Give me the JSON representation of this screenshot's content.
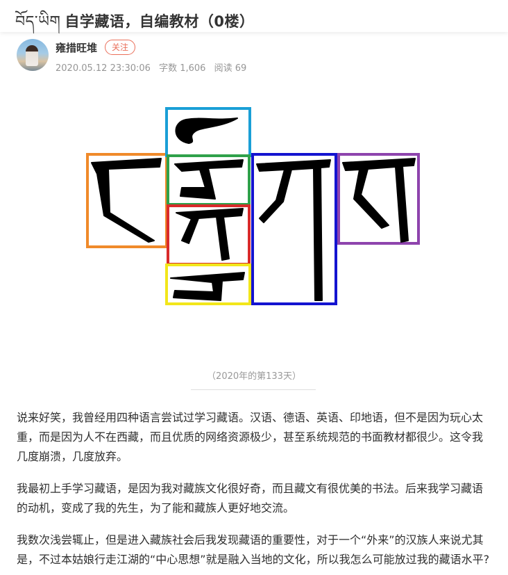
{
  "header": {
    "tibetan_logo": "བོད་ཡིག",
    "title": "自学藏语，自编教材（0楼）"
  },
  "author": {
    "name": "雍措旺堆",
    "follow_label": "关注",
    "date": "2020.05.12 23:30:06",
    "word_count": "字数 1,606",
    "reads": "阅读 69"
  },
  "figure": {
    "caption": "（2020年的第133天）",
    "box_colors": [
      "#f08a2a",
      "#1a9fd6",
      "#2fa14a",
      "#d92b2b",
      "#f2e61a",
      "#1414d0",
      "#8e44ad"
    ]
  },
  "paragraphs": [
    "说来好笑，我曾经用四种语言尝试过学习藏语。汉语、德语、英语、印地语，但不是因为玩心太重，而是因为人不在西藏，而且优质的网络资源极少，甚至系统规范的书面教材都很少。这令我几度崩溃，几度放弃。",
    "我最初上手学习藏语，是因为我对藏族文化很好奇，而且藏文有很优美的书法。后来我学习藏语的动机，变成了我的先生，为了能和藏族人更好地交流。",
    "我数次浅尝辄止，但是进入藏族社会后我发现藏语的重要性，对于一个“外来”的汉族人来说尤其是，不过本姑娘行走江湖的“中心思想”就是融入当地的文化，所以我怎么可能放过我的藏语水平?"
  ]
}
